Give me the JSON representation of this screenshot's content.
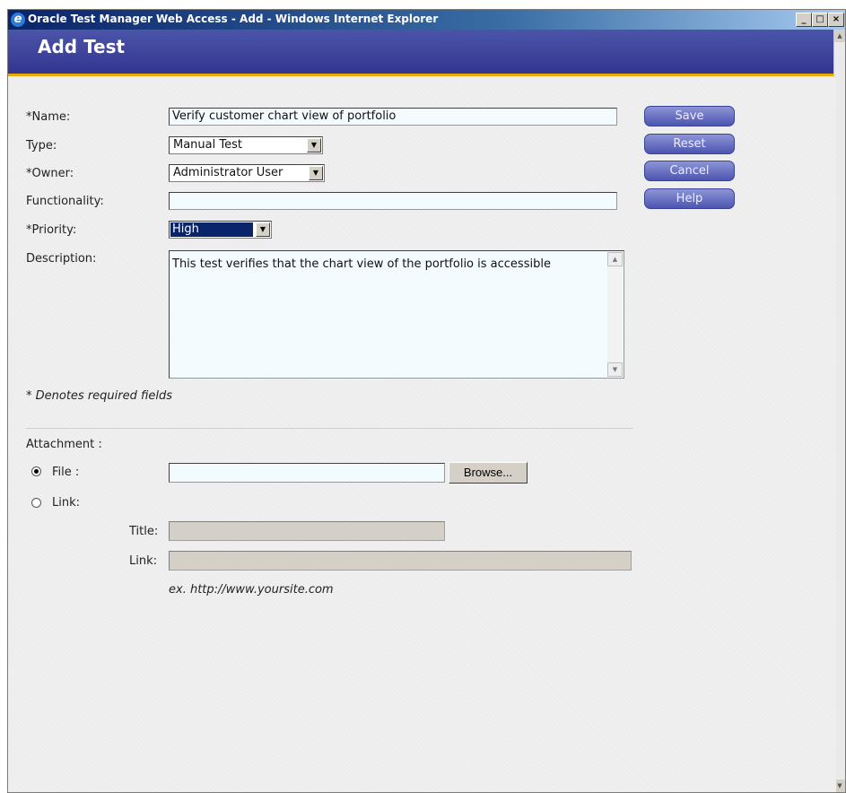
{
  "window": {
    "title": "Oracle Test Manager Web Access - Add - Windows Internet Explorer"
  },
  "header": {
    "title": "Add Test"
  },
  "form": {
    "name": {
      "label": "*Name:",
      "value": "Verify customer chart view of portfolio"
    },
    "type": {
      "label": "Type:",
      "value": "Manual Test"
    },
    "owner": {
      "label": "*Owner:",
      "value": "Administrator User"
    },
    "functionality": {
      "label": "Functionality:",
      "value": ""
    },
    "priority": {
      "label": "*Priority:",
      "value": "High"
    },
    "description": {
      "label": "Description:",
      "value": "This test verifies that the chart view of the portfolio is accessible"
    },
    "required_note": "* Denotes required fields"
  },
  "buttons": {
    "save": "Save",
    "reset": "Reset",
    "cancel": "Cancel",
    "help": "Help"
  },
  "attachment": {
    "label": "Attachment :",
    "file_option": "File :",
    "link_option": "Link:",
    "selected": "File",
    "browse": "Browse...",
    "title_label": "Title:",
    "link_label": "Link:",
    "example": "ex. http://www.yoursite.com"
  },
  "colors": {
    "header_bg": "#33358f",
    "header_accent": "#e8a800",
    "button_bg": "#5a62b8",
    "selection": "#0a246a"
  }
}
